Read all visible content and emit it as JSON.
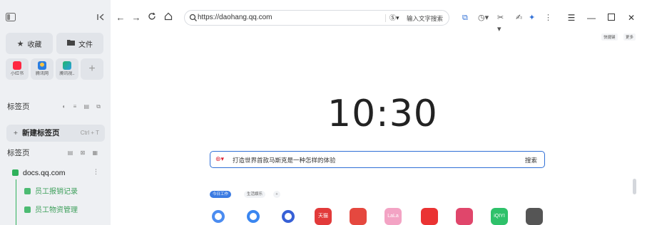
{
  "sidebar": {
    "favorites_label": "收藏",
    "files_label": "文件",
    "apps": [
      {
        "name": "小红书",
        "color": "#ff2741"
      },
      {
        "name": "腾讯网",
        "color": "#2a7de1"
      },
      {
        "name": "腾讯视..",
        "color": "#1fb66a"
      }
    ],
    "add_app_label": "+",
    "tabs_section_label": "标签页",
    "new_tab_label": "新建标签页",
    "new_tab_shortcut": "Ctrl + T",
    "tabs_group_label": "标签页",
    "group_name": "docs.qq.com",
    "docs": [
      "员工报销记录",
      "员工物资管理"
    ]
  },
  "toolbar": {
    "url": "https://daohang.qq.com",
    "search_placeholder": "输入文字搜索"
  },
  "mini_buttons": [
    "快捷键",
    "更多"
  ],
  "clock": "10:30",
  "search": {
    "query": "打造世界首款马斯克是一种怎样的体验",
    "button_label": "搜索"
  },
  "chips": [
    "今日工作",
    "生活娱乐",
    "+"
  ],
  "sites": [
    {
      "icon": "q-search-icon",
      "color": "#4b8cf0"
    },
    {
      "icon": "flower-icon",
      "color": "#3a86f0"
    },
    {
      "icon": "paw-icon",
      "color": "#3760d6"
    },
    {
      "icon": "tmall-icon",
      "color": "#e23a3a",
      "text": "天猫"
    },
    {
      "icon": "pinduoduo-icon",
      "color": "#e5483f"
    },
    {
      "icon": "lala-icon",
      "color": "#f3a3c4",
      "text": "LaLa"
    },
    {
      "icon": "youtube-icon",
      "color": "#ea3333"
    },
    {
      "icon": "pinterest-icon",
      "color": "#e0466b"
    },
    {
      "icon": "iqiyi-icon",
      "color": "#2ec16a",
      "text": "iQIYI"
    },
    {
      "icon": "figma-icon",
      "color": "#555555"
    }
  ]
}
